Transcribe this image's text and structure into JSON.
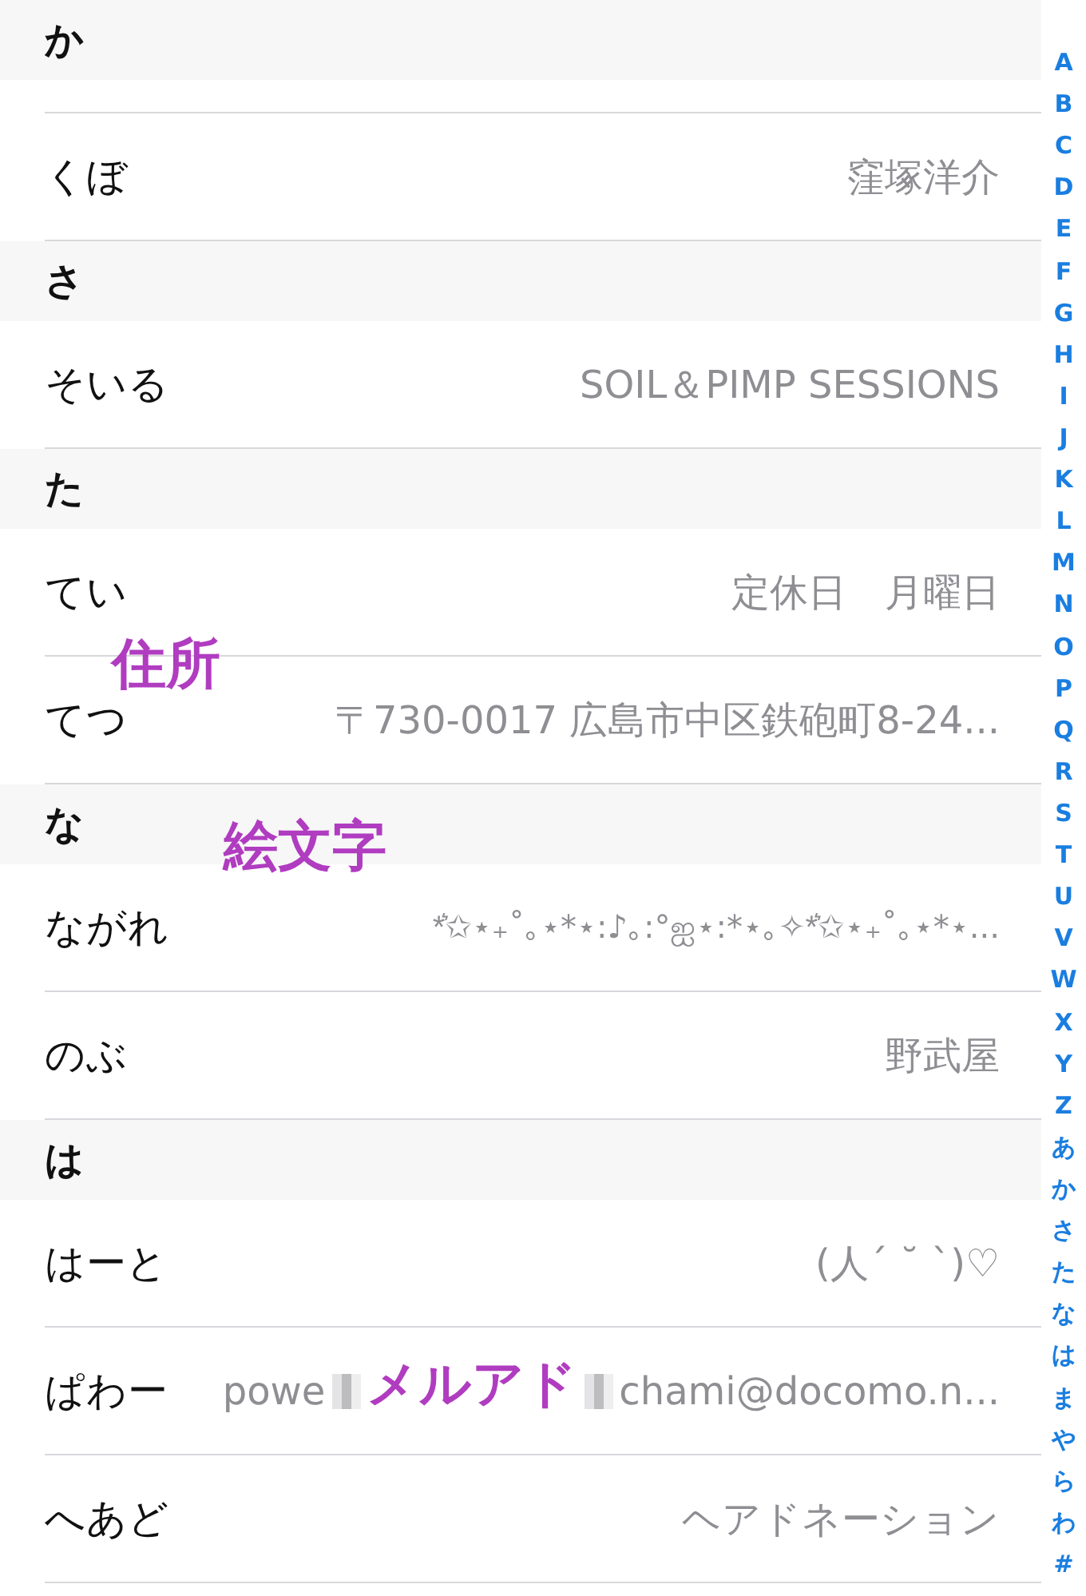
{
  "sections": [
    {
      "header": "か",
      "partial_row": true,
      "rows": [
        {
          "name": "くぼ",
          "detail": [
            {
              "kind": "text",
              "text": "窪塚洋介"
            }
          ]
        }
      ]
    },
    {
      "header": "さ",
      "rows": [
        {
          "name": "そいる",
          "detail": [
            {
              "kind": "text",
              "text": "SOIL＆PIMP SESSIONS"
            }
          ]
        }
      ]
    },
    {
      "header": "た",
      "rows": [
        {
          "name": "てい",
          "detail": [
            {
              "kind": "text",
              "text": "定休日　月曜日"
            }
          ]
        },
        {
          "name": "てつ",
          "annotation": "住所",
          "detail": [
            {
              "kind": "text",
              "text": "〒730-0017 広島市中区鉄砲町8-24..."
            }
          ]
        }
      ]
    },
    {
      "header": "な",
      "rows": [
        {
          "name": "ながれ",
          "annotation": "絵文字",
          "detail": [
            {
              "kind": "text",
              "text": "*͛✩⋆₊˚｡⋆*⋆:♪｡:°ஐ⋆:*⋆｡✧*͛✩⋆₊˚｡⋆*⋆..."
            }
          ]
        },
        {
          "name": "のぶ",
          "detail": [
            {
              "kind": "text",
              "text": "野武屋"
            }
          ]
        }
      ]
    },
    {
      "header": "は",
      "rows": [
        {
          "name": "はーと",
          "detail": [
            {
              "kind": "text",
              "text": "(人´ ˘ `)♡"
            }
          ]
        },
        {
          "name": "ぱわー",
          "annotation": "メルアド",
          "detail": [
            {
              "kind": "text",
              "text": "powe"
            },
            {
              "kind": "blur"
            },
            {
              "kind": "text",
              "text": "chami@docomo.n..."
            }
          ]
        },
        {
          "name": "へあど",
          "detail": [
            {
              "kind": "text",
              "text": "ヘアドネーション"
            }
          ]
        }
      ]
    }
  ],
  "index": [
    "A",
    "B",
    "C",
    "D",
    "E",
    "F",
    "G",
    "H",
    "I",
    "J",
    "K",
    "L",
    "M",
    "N",
    "O",
    "P",
    "Q",
    "R",
    "S",
    "T",
    "U",
    "V",
    "W",
    "X",
    "Y",
    "Z",
    "あ",
    "か",
    "さ",
    "た",
    "な",
    "は",
    "ま",
    "や",
    "ら",
    "わ",
    "#"
  ]
}
